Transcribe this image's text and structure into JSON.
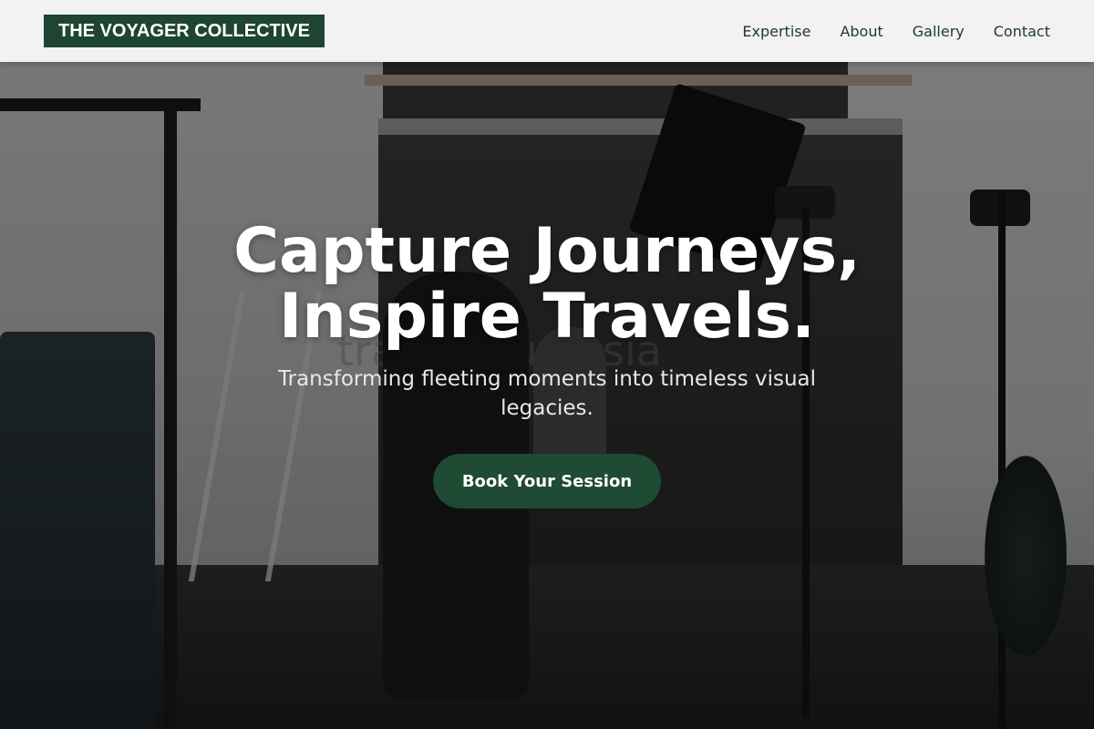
{
  "header": {
    "logo_text": "THE VOYAGER COLLECTIVE",
    "nav": [
      {
        "label": "Expertise"
      },
      {
        "label": "About"
      },
      {
        "label": "Gallery"
      },
      {
        "label": "Contact"
      }
    ]
  },
  "hero": {
    "title_line_1": "Capture Journeys,",
    "title_line_2": "Inspire Travels.",
    "subtitle": "Transforming fleeting moments into timeless visual legacies.",
    "cta_label": "Book Your Session",
    "background_image_text": "travelogue asia"
  },
  "colors": {
    "brand_green": "#1e4530",
    "header_bg": "#f2f2f2",
    "nav_text": "#1e3a2c",
    "cta_bg": "#1f4a33"
  }
}
